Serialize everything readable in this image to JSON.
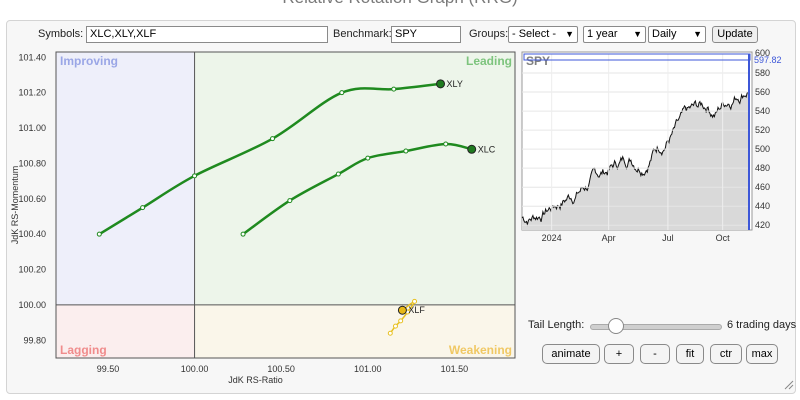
{
  "page": {
    "title": "Relative Rotation Graph (RRG)"
  },
  "controls": {
    "symbols_label": "Symbols:",
    "symbols_value": "XLC,XLY,XLF",
    "benchmark_label": "Benchmark:",
    "benchmark_value": "SPY",
    "groups_label": "Groups:",
    "groups_value": "- Select -",
    "period_value": "1 year",
    "frequency_value": "Daily",
    "update_label": "Update"
  },
  "rrg": {
    "quadrants": {
      "improving": "Improving",
      "leading": "Leading",
      "lagging": "Lagging",
      "weakening": "Weakening"
    },
    "colors": {
      "improving": "#9aa6e6",
      "leading": "#7dc47d",
      "lagging": "#f08c8c",
      "weakening": "#f0c864",
      "tail_green": "#1f8a1f",
      "tail_yellow": "#e8c020"
    },
    "xlabel": "JdK RS-Ratio",
    "ylabel": "JdK RS-Momentum",
    "x_ticks": [
      "99.50",
      "100.00",
      "100.50",
      "101.00",
      "101.50"
    ],
    "y_ticks": [
      "101.40",
      "101.20",
      "101.00",
      "100.80",
      "100.60",
      "100.40",
      "100.20",
      "100.00",
      "99.80"
    ],
    "series": [
      {
        "name": "XLY",
        "points": [
          [
            99.45,
            100.4
          ],
          [
            99.7,
            100.55
          ],
          [
            100.0,
            100.73
          ],
          [
            100.45,
            100.94
          ],
          [
            100.85,
            101.2
          ],
          [
            101.15,
            101.22
          ],
          [
            101.42,
            101.25
          ]
        ]
      },
      {
        "name": "XLC",
        "points": [
          [
            100.28,
            100.4
          ],
          [
            100.55,
            100.59
          ],
          [
            100.83,
            100.74
          ],
          [
            101.0,
            100.83
          ],
          [
            101.22,
            100.87
          ],
          [
            101.45,
            100.91
          ],
          [
            101.6,
            100.88
          ]
        ]
      },
      {
        "name": "XLF",
        "points": [
          [
            101.13,
            99.84
          ],
          [
            101.16,
            99.88
          ],
          [
            101.19,
            99.91
          ],
          [
            101.23,
            99.96
          ],
          [
            101.27,
            100.02
          ],
          [
            101.2,
            99.97
          ]
        ]
      }
    ]
  },
  "spy_chart": {
    "title": "SPY",
    "last_value": "597.82",
    "y_ticks": [
      "580",
      "560",
      "540",
      "520",
      "500",
      "480",
      "460",
      "440",
      "420"
    ],
    "top_tick": "600",
    "x_ticks": [
      "2024",
      "Apr",
      "Jul",
      "Oct"
    ]
  },
  "tail": {
    "label": "Tail Length:",
    "value_label": "6 trading days",
    "value": 6
  },
  "buttons": {
    "animate": "animate",
    "plus": "+",
    "minus": "-",
    "fit": "fit",
    "ctr": "ctr",
    "max": "max"
  }
}
